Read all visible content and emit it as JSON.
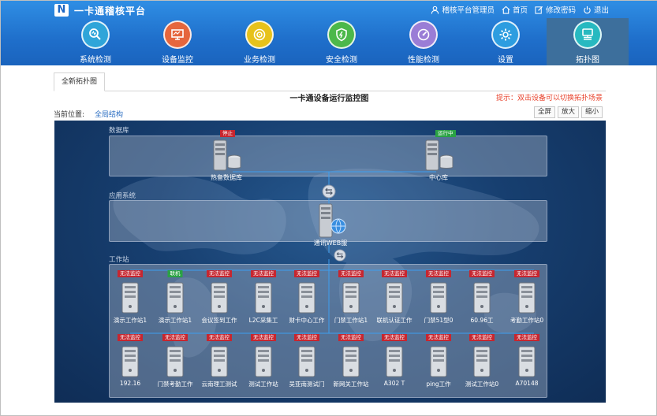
{
  "app": {
    "logo_letter": "N",
    "title": "一卡通稽核平台"
  },
  "user_links": [
    {
      "name": "user",
      "label": "稽核平台管理员"
    },
    {
      "name": "home",
      "label": "首页"
    },
    {
      "name": "password",
      "label": "修改密码"
    },
    {
      "name": "logout",
      "label": "退出"
    }
  ],
  "nav": [
    {
      "label": "系统检测",
      "icon": "system-check-icon",
      "color": "#2fa5d9"
    },
    {
      "label": "设备监控",
      "icon": "device-monitor-icon",
      "color": "#e5663d"
    },
    {
      "label": "业务检测",
      "icon": "business-check-icon",
      "color": "#e7c21b"
    },
    {
      "label": "安全检测",
      "icon": "security-icon",
      "color": "#4cb84a"
    },
    {
      "label": "性能检测",
      "icon": "performance-icon",
      "color": "#9a7dd6"
    },
    {
      "label": "设置",
      "icon": "gear-icon",
      "color": "#2d9de0"
    },
    {
      "label": "拓扑图",
      "icon": "topology-icon",
      "color": "#27b9c0",
      "active": true
    }
  ],
  "tab": {
    "label": "全新拓扑图"
  },
  "diagram": {
    "title": "一卡通设备运行监控图",
    "hint": "提示：双击设备可以切换拓扑场景",
    "location_label": "当前位置:",
    "location_link": "全局结构",
    "buttons": {
      "fullscreen": "全屏",
      "zoom_in": "放大",
      "zoom_out": "缩小"
    }
  },
  "zones": {
    "database": "数据库",
    "application": "应用系统",
    "workstation": "工作站"
  },
  "db_nodes": [
    {
      "label": "热备数据库",
      "status": "停止",
      "status_color": "red"
    },
    {
      "label": "中心库",
      "status": "运行中",
      "status_color": "green"
    }
  ],
  "app_node": {
    "label": "通讯WEB服"
  },
  "workstations_row1": [
    {
      "label": "演示工作站1",
      "status": "无法监控",
      "status_color": "red"
    },
    {
      "label": "演示工作站1",
      "status": "联机",
      "status_color": "green"
    },
    {
      "label": "会议签到工作",
      "status": "无法监控",
      "status_color": "red"
    },
    {
      "label": "L2C采集工",
      "status": "无法监控",
      "status_color": "red"
    },
    {
      "label": "财卡中心工作",
      "status": "无法监控",
      "status_color": "red"
    },
    {
      "label": "门禁工作站1",
      "status": "无法监控",
      "status_color": "red"
    },
    {
      "label": "联机认证工作",
      "status": "无法监控",
      "status_color": "red"
    },
    {
      "label": "门禁51型0",
      "status": "无法监控",
      "status_color": "red"
    },
    {
      "label": "60.96工",
      "status": "无法监控",
      "status_color": "red"
    },
    {
      "label": "考勤工作站0",
      "status": "无法监控",
      "status_color": "red"
    }
  ],
  "workstations_row2": [
    {
      "label": "192.16",
      "status": "无法监控",
      "status_color": "red"
    },
    {
      "label": "门禁考勤工作",
      "status": "无法监控",
      "status_color": "red"
    },
    {
      "label": "云南理工测试",
      "status": "无法监控",
      "status_color": "red"
    },
    {
      "label": "测试工作站",
      "status": "无法监控",
      "status_color": "red"
    },
    {
      "label": "吴亚南测试门",
      "status": "无法监控",
      "status_color": "red"
    },
    {
      "label": "新网关工作站",
      "status": "无法监控",
      "status_color": "red"
    },
    {
      "label": "A302 T",
      "status": "无法监控",
      "status_color": "red"
    },
    {
      "label": "ping工作",
      "status": "无法监控",
      "status_color": "red"
    },
    {
      "label": "测试工作站0",
      "status": "无法监控",
      "status_color": "red"
    },
    {
      "label": "A70148",
      "status": "无法监控",
      "status_color": "red"
    }
  ]
}
